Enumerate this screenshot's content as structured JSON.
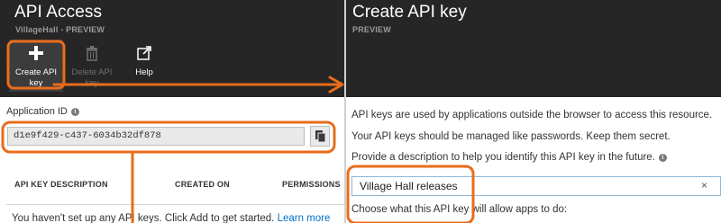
{
  "left_blade": {
    "title": "API Access",
    "subtitle": "VillageHall - PREVIEW",
    "commands": {
      "create_label": "Create API key",
      "delete_label": "Delete API key",
      "help_label": "Help"
    },
    "app_id_label": "Application ID",
    "app_id_value": "d1e9f429-c437-6034b32df878",
    "table_headers": {
      "description": "API KEY DESCRIPTION",
      "created": "CREATED ON",
      "permissions": "PERMISSIONS"
    },
    "empty_message": "You haven't set up any API keys. Click Add to get started.",
    "learn_more": "Learn more"
  },
  "right_blade": {
    "title": "Create API key",
    "subtitle": "PREVIEW",
    "line1": "API keys are used by applications outside the browser to access this resource.",
    "line2": "Your API keys should be managed like passwords. Keep them secret.",
    "line3": "Provide a description to help you identify this API key in the future.",
    "description_value": "Village Hall releases",
    "clear_glyph": "×",
    "permissions_prompt": "Choose what this API key will allow apps to do:"
  },
  "colors": {
    "header_bg": "#262626",
    "annotation": "#e96c1b",
    "link": "#0072c6"
  },
  "icons": [
    "plus-icon",
    "trash-icon",
    "external-link-icon",
    "copy-icon",
    "info-icon",
    "clear-icon"
  ]
}
